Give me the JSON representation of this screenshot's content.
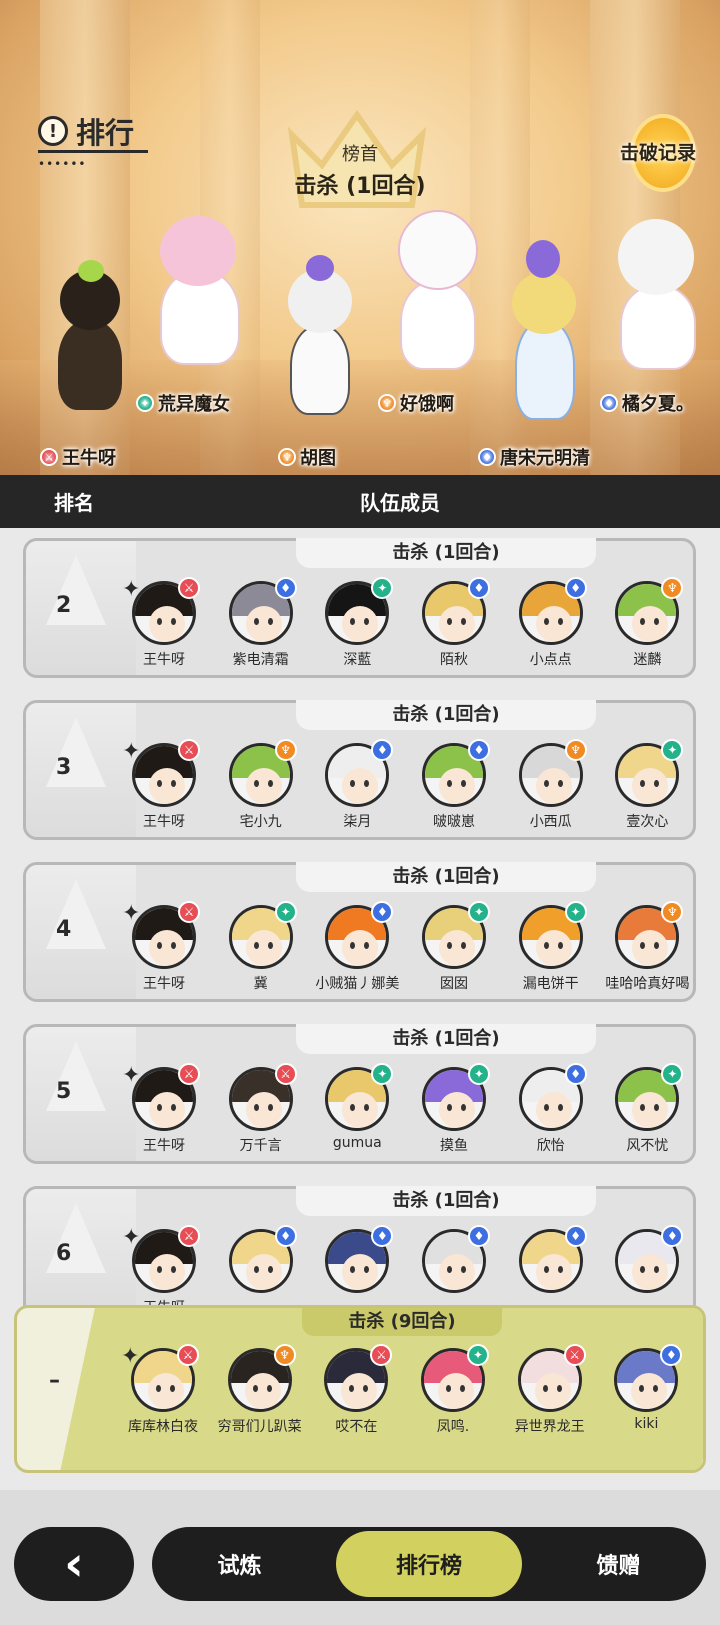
{
  "banner": {
    "title": "排行",
    "top_label": "榜首",
    "top_title": "击杀 (1回合)",
    "record_button": "击破记录",
    "heroes": [
      {
        "name": "王牛呀",
        "badge": "red"
      },
      {
        "name": "荒异魔女",
        "badge": "green"
      },
      {
        "name": "胡图",
        "badge": "orange"
      },
      {
        "name": "好饿啊",
        "badge": "orange"
      },
      {
        "name": "唐宋元明清",
        "badge": "blue"
      },
      {
        "name": "橘夕夏。",
        "badge": "blue"
      }
    ]
  },
  "header": {
    "rank_col": "排名",
    "team_col": "队伍成员"
  },
  "rows": [
    {
      "rank": "2",
      "result": "击杀 (1回合)",
      "members": [
        {
          "name": "王牛呀",
          "elem": "red",
          "hair": "#1f1a16",
          "lead": true
        },
        {
          "name": "紫电清霜",
          "elem": "blue",
          "hair": "#8c8a96"
        },
        {
          "name": "深藍",
          "elem": "green",
          "hair": "#151515"
        },
        {
          "name": "陌秋",
          "elem": "blue",
          "hair": "#e8c86a"
        },
        {
          "name": "小点点",
          "elem": "blue",
          "hair": "#e8a53a"
        },
        {
          "name": "迷麟",
          "elem": "orange",
          "hair": "#8cc24a"
        }
      ]
    },
    {
      "rank": "3",
      "result": "击杀 (1回合)",
      "members": [
        {
          "name": "王牛呀",
          "elem": "red",
          "hair": "#1f1a16",
          "lead": true
        },
        {
          "name": "宅小九",
          "elem": "orange",
          "hair": "#8cc24a"
        },
        {
          "name": "柒月",
          "elem": "blue",
          "hair": "#eeeeee"
        },
        {
          "name": "啵啵崽",
          "elem": "blue",
          "hair": "#8cc24a"
        },
        {
          "name": "小西瓜",
          "elem": "orange",
          "hair": "#d8d8d8"
        },
        {
          "name": "壹次心",
          "elem": "green",
          "hair": "#f0d68a"
        }
      ]
    },
    {
      "rank": "4",
      "result": "击杀 (1回合)",
      "members": [
        {
          "name": "王牛呀",
          "elem": "red",
          "hair": "#1f1a16",
          "lead": true
        },
        {
          "name": "冀",
          "elem": "green",
          "hair": "#f0d68a"
        },
        {
          "name": "小贼猫丿娜美",
          "elem": "blue",
          "hair": "#f07a22"
        },
        {
          "name": "囡囡",
          "elem": "green",
          "hair": "#e8d07a"
        },
        {
          "name": "漏电饼干",
          "elem": "green",
          "hair": "#f0a02a"
        },
        {
          "name": "哇哈哈真好喝",
          "elem": "orange",
          "hair": "#e87a3a"
        }
      ]
    },
    {
      "rank": "5",
      "result": "击杀 (1回合)",
      "members": [
        {
          "name": "王牛呀",
          "elem": "red",
          "hair": "#1f1a16",
          "lead": true
        },
        {
          "name": "万千言",
          "elem": "red",
          "hair": "#3a302a"
        },
        {
          "name": "gumua",
          "elem": "green",
          "hair": "#e8c86a"
        },
        {
          "name": "摸鱼",
          "elem": "green",
          "hair": "#8a6ad8"
        },
        {
          "name": "欣怡",
          "elem": "blue",
          "hair": "#eeeeee"
        },
        {
          "name": "风不忧",
          "elem": "green",
          "hair": "#8cc24a"
        }
      ]
    },
    {
      "rank": "6",
      "result": "击杀 (1回合)",
      "members": [
        {
          "name": "王牛呀",
          "elem": "red",
          "hair": "#1f1a16",
          "lead": true
        },
        {
          "name": "",
          "elem": "blue",
          "hair": "#f0d68a"
        },
        {
          "name": "",
          "elem": "blue",
          "hair": "#3a4a8a"
        },
        {
          "name": "",
          "elem": "blue",
          "hair": "#e0e0e0"
        },
        {
          "name": "",
          "elem": "blue",
          "hair": "#f0d68a"
        },
        {
          "name": "",
          "elem": "blue",
          "hair": "#e8e8ee"
        }
      ]
    }
  ],
  "my_team": {
    "rank": "–",
    "result": "击杀 (9回合)",
    "members": [
      {
        "name": "库库林白夜",
        "elem": "red",
        "hair": "#f0d68a",
        "lead": true
      },
      {
        "name": "穷哥们儿趴菜",
        "elem": "orange",
        "hair": "#2a2420"
      },
      {
        "name": "哎不在",
        "elem": "red",
        "hair": "#2a2a3a"
      },
      {
        "name": "凤鸣.",
        "elem": "green",
        "hair": "#e85a7a"
      },
      {
        "name": "异世界龙王",
        "elem": "red",
        "hair": "#f2dede"
      },
      {
        "name": "kiki",
        "elem": "blue",
        "hair": "#6a7ac8"
      }
    ]
  },
  "nav": {
    "back": "‹",
    "tabs": [
      "试炼",
      "排行榜",
      "馈赠"
    ],
    "active": 1
  },
  "colors": {
    "red": "#e64d55",
    "orange": "#f08a22",
    "blue": "#3d6fe0",
    "green": "#23b28a",
    "accent": "#d2d05e"
  }
}
